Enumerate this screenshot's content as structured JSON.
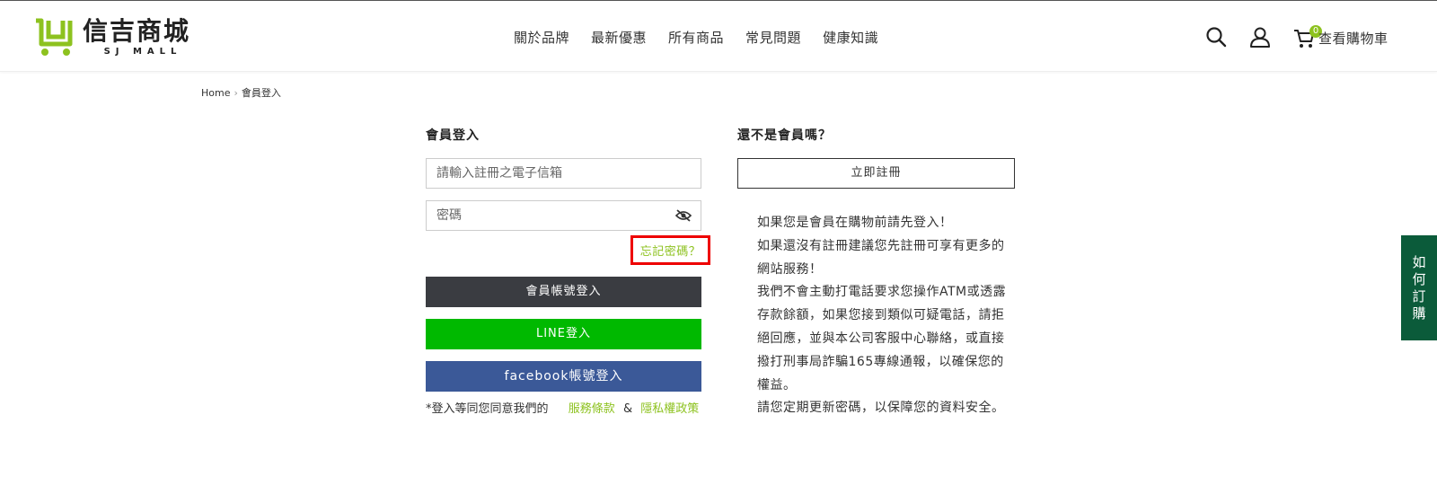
{
  "header": {
    "logo": {
      "cn": "信吉商城",
      "en": "SJ MALL"
    },
    "nav": [
      "關於品牌",
      "最新優惠",
      "所有商品",
      "常見問題",
      "健康知識"
    ],
    "cart": {
      "count": "0",
      "label": "查看購物車"
    },
    "icons": [
      "search-icon",
      "user-icon",
      "cart-icon"
    ]
  },
  "breadcrumb": {
    "home": "Home",
    "current": "會員登入"
  },
  "login": {
    "title": "會員登入",
    "email_placeholder": "請輸入註冊之電子信箱",
    "password_placeholder": "密碼",
    "forgot": "忘記密碼？",
    "member_login": "會員帳號登入",
    "line_login": "LINE登入",
    "facebook_login": "facebook帳號登入",
    "terms_prefix": "*登入等同您同意我們的",
    "terms_link": "服務條款",
    "terms_and": "&",
    "privacy_link": "隱私權政策"
  },
  "register": {
    "title": "還不是會員嗎？",
    "button": "立即註冊",
    "notes": [
      "如果您是會員在購物前請先登入！",
      "如果還沒有註冊建議您先註冊可享有更多的網站服務！",
      "我們不會主動打電話要求您操作ATM或透露存款餘額，如果您接到類似可疑電話，請拒絕回應，並與本公司客服中心聯絡，或直接撥打刑事局詐騙165專線通報，以確保您的權益。",
      "請您定期更新密碼，以保障您的資料安全。"
    ]
  },
  "side_tab": [
    "如",
    "何",
    "訂",
    "購"
  ],
  "colors": {
    "accent": "#8dc21f",
    "dark_button": "#3a3c41",
    "line": "#00b900",
    "facebook": "#3b5998",
    "side_tab": "#0b5b3a",
    "highlight": "#e00000"
  }
}
